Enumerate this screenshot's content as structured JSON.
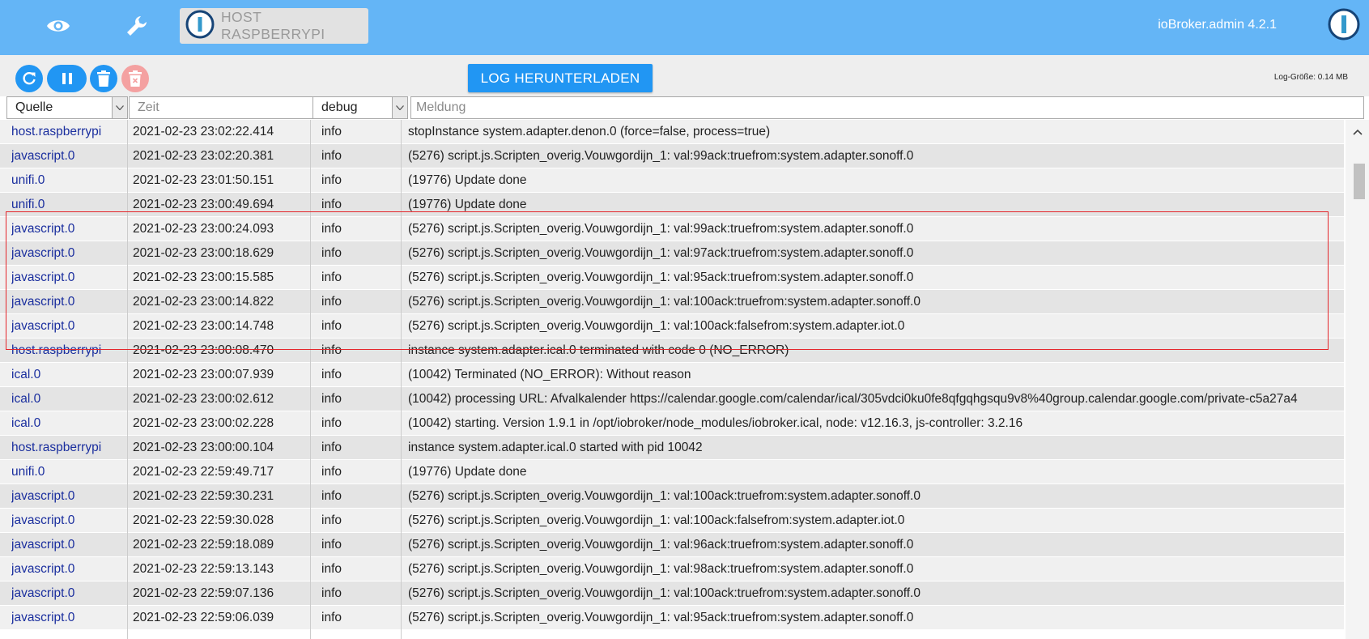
{
  "header": {
    "host_label": "HOST RASPBERRYPI",
    "app_version": "ioBroker.admin 4.2.1"
  },
  "toolbar": {
    "download_label": "LOG HERUNTERLADEN",
    "log_size": "Log-Größe: 0.14 MB"
  },
  "filters": {
    "source": "Quelle",
    "time_placeholder": "Zeit",
    "severity": "debug",
    "message_placeholder": "Meldung"
  },
  "colors": {
    "accent": "#2196f3",
    "header": "#64b5f6",
    "highlight_border": "#e4262b"
  },
  "log_rows": [
    {
      "source": "host.raspberrypi",
      "time": "2021-02-23 23:02:22.414",
      "severity": "info",
      "message": "stopInstance system.adapter.denon.0 (force=false, process=true)"
    },
    {
      "source": "javascript.0",
      "time": "2021-02-23 23:02:20.381",
      "severity": "info",
      "message": "(5276) script.js.Scripten_overig.Vouwgordijn_1: val:99ack:truefrom:system.adapter.sonoff.0"
    },
    {
      "source": "unifi.0",
      "time": "2021-02-23 23:01:50.151",
      "severity": "info",
      "message": "(19776) Update done"
    },
    {
      "source": "unifi.0",
      "time": "2021-02-23 23:00:49.694",
      "severity": "info",
      "message": "(19776) Update done"
    },
    {
      "source": "javascript.0",
      "time": "2021-02-23 23:00:24.093",
      "severity": "info",
      "message": "(5276) script.js.Scripten_overig.Vouwgordijn_1: val:99ack:truefrom:system.adapter.sonoff.0"
    },
    {
      "source": "javascript.0",
      "time": "2021-02-23 23:00:18.629",
      "severity": "info",
      "message": "(5276) script.js.Scripten_overig.Vouwgordijn_1: val:97ack:truefrom:system.adapter.sonoff.0"
    },
    {
      "source": "javascript.0",
      "time": "2021-02-23 23:00:15.585",
      "severity": "info",
      "message": "(5276) script.js.Scripten_overig.Vouwgordijn_1: val:95ack:truefrom:system.adapter.sonoff.0"
    },
    {
      "source": "javascript.0",
      "time": "2021-02-23 23:00:14.822",
      "severity": "info",
      "message": "(5276) script.js.Scripten_overig.Vouwgordijn_1: val:100ack:truefrom:system.adapter.sonoff.0"
    },
    {
      "source": "javascript.0",
      "time": "2021-02-23 23:00:14.748",
      "severity": "info",
      "message": "(5276) script.js.Scripten_overig.Vouwgordijn_1: val:100ack:falsefrom:system.adapter.iot.0"
    },
    {
      "source": "host.raspberrypi",
      "time": "2021-02-23 23:00:08.470",
      "severity": "info",
      "message": "instance system.adapter.ical.0 terminated with code 0 (NO_ERROR)"
    },
    {
      "source": "ical.0",
      "time": "2021-02-23 23:00:07.939",
      "severity": "info",
      "message": "(10042) Terminated (NO_ERROR): Without reason"
    },
    {
      "source": "ical.0",
      "time": "2021-02-23 23:00:02.612",
      "severity": "info",
      "message": "(10042) processing URL: Afvalkalender https://calendar.google.com/calendar/ical/305vdci0ku0fe8qfgqhgsqu9v8%40group.calendar.google.com/private-c5a27a4"
    },
    {
      "source": "ical.0",
      "time": "2021-02-23 23:00:02.228",
      "severity": "info",
      "message": "(10042) starting. Version 1.9.1 in /opt/iobroker/node_modules/iobroker.ical, node: v12.16.3, js-controller: 3.2.16"
    },
    {
      "source": "host.raspberrypi",
      "time": "2021-02-23 23:00:00.104",
      "severity": "info",
      "message": "instance system.adapter.ical.0 started with pid 10042"
    },
    {
      "source": "unifi.0",
      "time": "2021-02-23 22:59:49.717",
      "severity": "info",
      "message": "(19776) Update done"
    },
    {
      "source": "javascript.0",
      "time": "2021-02-23 22:59:30.231",
      "severity": "info",
      "message": "(5276) script.js.Scripten_overig.Vouwgordijn_1: val:100ack:truefrom:system.adapter.sonoff.0"
    },
    {
      "source": "javascript.0",
      "time": "2021-02-23 22:59:30.028",
      "severity": "info",
      "message": "(5276) script.js.Scripten_overig.Vouwgordijn_1: val:100ack:falsefrom:system.adapter.iot.0"
    },
    {
      "source": "javascript.0",
      "time": "2021-02-23 22:59:18.089",
      "severity": "info",
      "message": "(5276) script.js.Scripten_overig.Vouwgordijn_1: val:96ack:truefrom:system.adapter.sonoff.0"
    },
    {
      "source": "javascript.0",
      "time": "2021-02-23 22:59:13.143",
      "severity": "info",
      "message": "(5276) script.js.Scripten_overig.Vouwgordijn_1: val:98ack:truefrom:system.adapter.sonoff.0"
    },
    {
      "source": "javascript.0",
      "time": "2021-02-23 22:59:07.136",
      "severity": "info",
      "message": "(5276) script.js.Scripten_overig.Vouwgordijn_1: val:100ack:truefrom:system.adapter.sonoff.0"
    },
    {
      "source": "javascript.0",
      "time": "2021-02-23 22:59:06.039",
      "severity": "info",
      "message": "(5276) script.js.Scripten_overig.Vouwgordijn_1: val:95ack:truefrom:system.adapter.sonoff.0"
    }
  ]
}
